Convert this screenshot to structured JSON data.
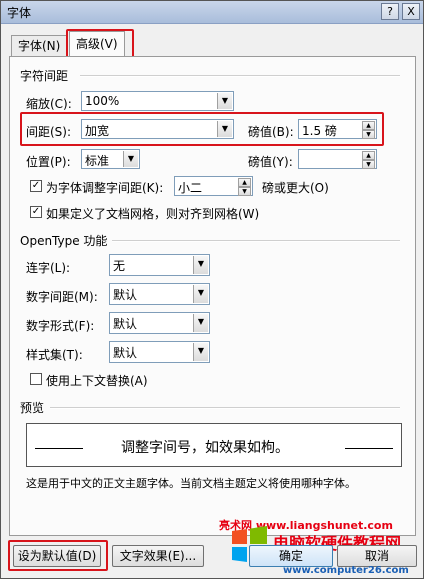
{
  "window": {
    "title": "字体",
    "help": "?",
    "close": "X"
  },
  "tabs": [
    {
      "label": "字体(N)"
    },
    {
      "label": "高级(V)"
    }
  ],
  "spacing": {
    "section": "字符间距",
    "scale": {
      "label": "缩放(C):",
      "value": "100%"
    },
    "spacing": {
      "label": "间距(S):",
      "value": "加宽",
      "by_label": "磅值(B):",
      "by_value": "1.5 磅"
    },
    "position": {
      "label": "位置(P):",
      "value": "标准",
      "by_label": "磅值(Y):",
      "by_value": ""
    },
    "kerning": {
      "label": "为字体调整字间距(K):",
      "value": "小二",
      "suffix": "磅或更大(O)",
      "checked": true
    },
    "snap_grid": {
      "label": "如果定义了文档网格，则对齐到网格(W)",
      "checked": true
    }
  },
  "opentype": {
    "section": "OpenType 功能",
    "ligatures": {
      "label": "连字(L):",
      "value": "无"
    },
    "number_spacing": {
      "label": "数字间距(M):",
      "value": "默认"
    },
    "number_forms": {
      "label": "数字形式(F):",
      "value": "默认"
    },
    "stylistic_sets": {
      "label": "样式集(T):",
      "value": "默认"
    },
    "contextual_alt": {
      "label": "使用上下文替换(A)",
      "checked": false
    }
  },
  "preview": {
    "section": "预览",
    "text": "调整字间号，如效果如枸。",
    "note": "这是用于中文的正文主题字体。当前文档主题定义将使用哪种字体。"
  },
  "buttons": {
    "default": "设为默认值(D)",
    "effects": "文字效果(E)...",
    "ok": "确定",
    "cancel": "取消"
  },
  "watermark": {
    "text1": "亮术网 www.liangshunet.com",
    "text2": "电脑软硬件教程网",
    "text3": "www.computer26.com"
  },
  "colors": {
    "highlight": "#d8141b",
    "watermark_red": "#e60012",
    "watermark_blue": "#1a5fb4"
  }
}
